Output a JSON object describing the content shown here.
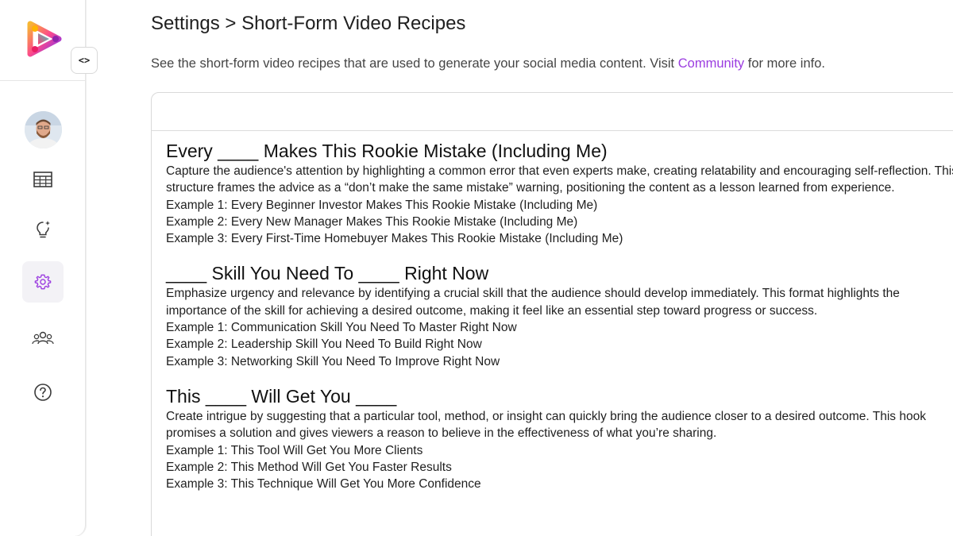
{
  "sidebar": {
    "collapse_label": "<>",
    "nav": [
      {
        "name": "table-icon"
      },
      {
        "name": "lightbulb-icon"
      },
      {
        "name": "settings-icon",
        "active": true
      },
      {
        "name": "users-icon"
      },
      {
        "name": "help-icon"
      }
    ],
    "accent_color": "#9b3ce0"
  },
  "header": {
    "title": "Settings > Short-Form Video Recipes",
    "subtitle_before": "See the short-form video recipes that are used to generate your social media content. Visit ",
    "subtitle_link": "Community",
    "subtitle_after": " for more info."
  },
  "recipes": [
    {
      "title": "Every ____ Makes This Rookie Mistake (Including Me)",
      "description": "Capture the audience's attention by highlighting a common error that even experts make, creating relatability and encouraging self-reflection. This structure frames the advice as a “don’t make the same mistake” warning, positioning the content as a lesson learned from experience.",
      "examples": [
        "Example 1: Every Beginner Investor Makes This Rookie Mistake (Including Me)",
        "Example 2: Every New Manager Makes This Rookie Mistake (Including Me)",
        "Example 3: Every First-Time Homebuyer Makes This Rookie Mistake (Including Me)"
      ]
    },
    {
      "title": "____ Skill You Need To ____ Right Now",
      "description": "Emphasize urgency and relevance by identifying a crucial skill that the audience should develop immediately. This format highlights the importance of the skill for achieving a desired outcome, making it feel like an essential step toward progress or success.",
      "examples": [
        "Example 1: Communication Skill You Need To Master Right Now",
        "Example 2: Leadership Skill You Need To Build Right Now",
        "Example 3: Networking Skill You Need To Improve Right Now"
      ]
    },
    {
      "title": "This ____ Will Get You ____",
      "description": "Create intrigue by suggesting that a particular tool, method, or insight can quickly bring the audience closer to a desired outcome. This hook promises a solution and gives viewers a reason to believe in the effectiveness of what you’re sharing.",
      "examples": [
        "Example 1: This Tool Will Get You More Clients",
        "Example 2: This Method Will Get You Faster Results",
        "Example 3: This Technique Will Get You More Confidence"
      ]
    }
  ]
}
